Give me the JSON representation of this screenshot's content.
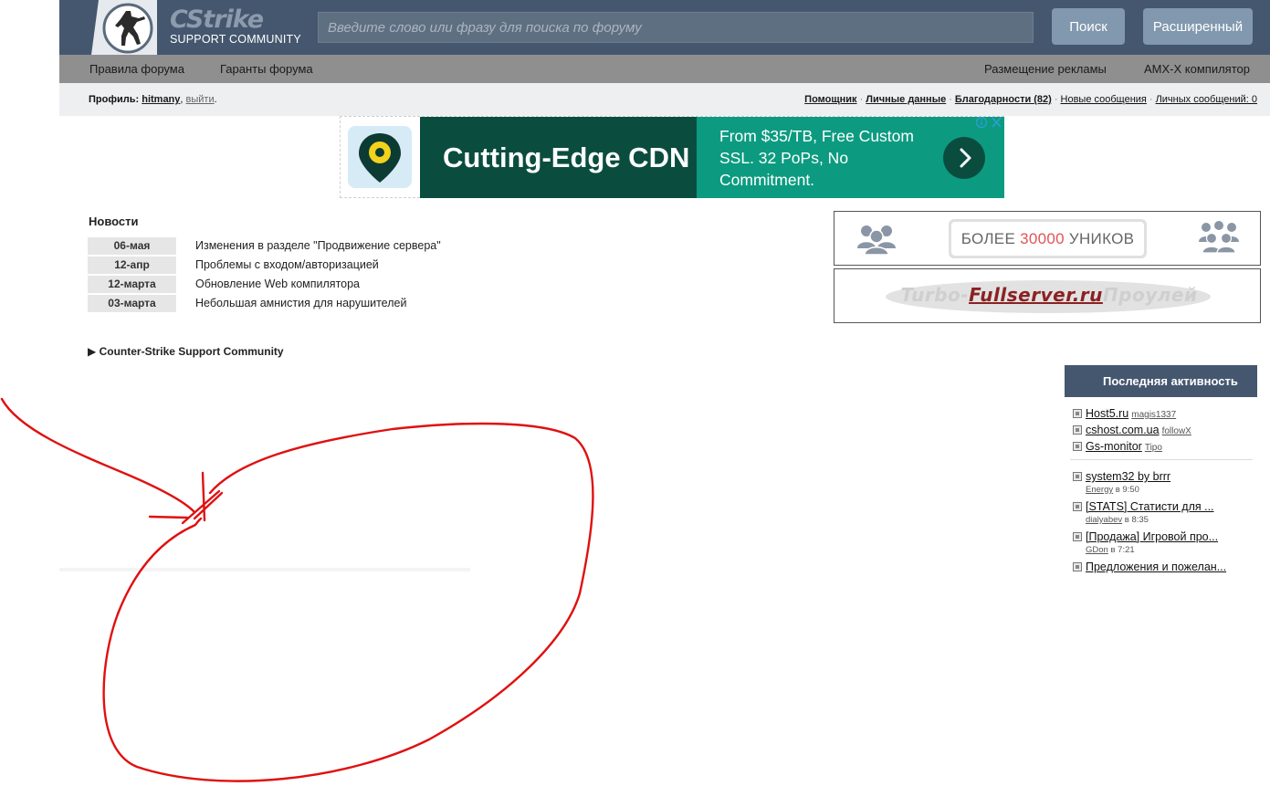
{
  "header": {
    "logo_main": "CStrike",
    "logo_sub": "SUPPORT COMMUNITY",
    "search_placeholder": "Введите слово или фразу для поиска по форуму",
    "search_button": "Поиск",
    "advanced_button": "Расширенный",
    "colors": {
      "bar": "#45576e",
      "button": "#8198ae"
    }
  },
  "nav": {
    "left": [
      "Правила форума",
      "Гаранты форума"
    ],
    "right": [
      "Размещение рекламы",
      "AMX-X компилятор"
    ]
  },
  "profile": {
    "label": "Профиль:",
    "username": "hitmany",
    "logout": "выйти",
    "links": [
      "Помощник",
      "Личные данные",
      "Благодарности (82)",
      "Новые сообщения",
      "Личных сообщений: 0"
    ]
  },
  "ad": {
    "headline": "Cutting-Edge CDN",
    "body": "From $35/TB, Free Custom SSL. 32 PoPs, No Commitment.",
    "icon": "location-pin-icon",
    "colors": {
      "dark": "#0a4d3f",
      "teal": "#0c9b80"
    }
  },
  "news": {
    "title": "Новости",
    "items": [
      {
        "date": "06-мая",
        "text": "Изменения в разделе \"Продвижение сервера\""
      },
      {
        "date": "12-апр",
        "text": "Проблемы с входом/авторизацией"
      },
      {
        "date": "12-марта",
        "text": "Обновление Web компилятора"
      },
      {
        "date": "03-марта",
        "text": "Небольшая амнистия для нарушителей"
      }
    ]
  },
  "forum_link": "Counter-Strike Support Community",
  "banners": {
    "uniks_prefix": "БОЛЕЕ",
    "uniks_number": "30000",
    "uniks_suffix": "УНИКОВ",
    "turbo_left": "Turbo-",
    "turbo_mid": "Fullserver.ru",
    "turbo_right": "Проулей"
  },
  "activity": {
    "title": "Последняя активность",
    "servers": [
      {
        "name": "Host5.ru",
        "user": "magis1337"
      },
      {
        "name": "cshost.com.ua",
        "user": "followX"
      },
      {
        "name": "Gs-monitor",
        "user": "Tipo"
      }
    ],
    "topics": [
      {
        "title": "system32 by brrr",
        "user": "Energy",
        "time": "в 9:50"
      },
      {
        "title": "[STATS] Статисти для ...",
        "user": "dialyabev",
        "time": "в 8:35"
      },
      {
        "title": "[Продажа] Игровой про...",
        "user": "GDon",
        "time": "в 7:21"
      },
      {
        "title": "Предложения и пожелан...",
        "user": "",
        "time": ""
      }
    ]
  },
  "annotation_color": "#e01010"
}
